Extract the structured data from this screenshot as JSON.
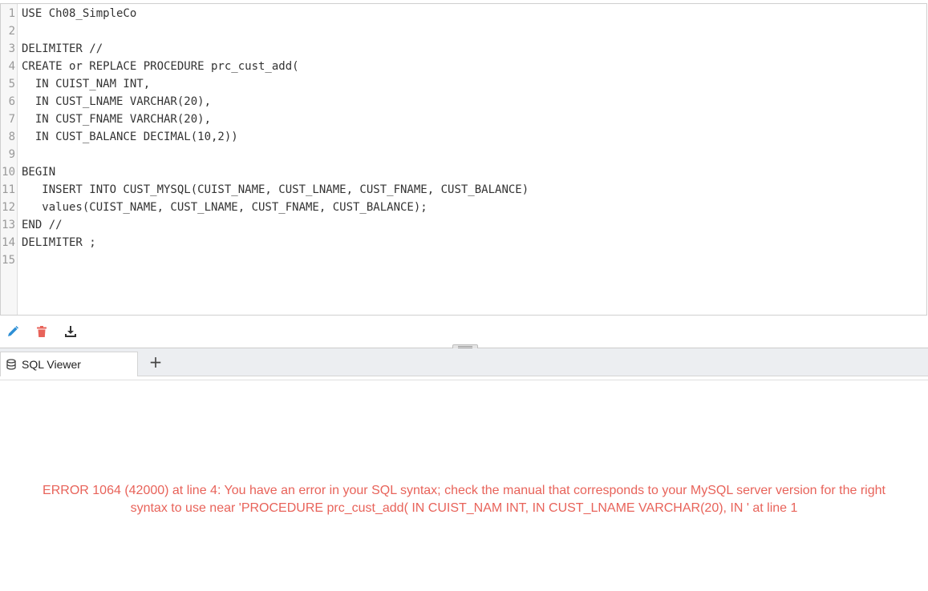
{
  "editor": {
    "line_numbers": [
      "1",
      "2",
      "3",
      "4",
      "5",
      "6",
      "7",
      "8",
      "9",
      "10",
      "11",
      "12",
      "13",
      "14",
      "15"
    ],
    "lines": [
      "USE Ch08_SimpleCo",
      "",
      "DELIMITER //",
      "CREATE or REPLACE PROCEDURE prc_cust_add(",
      "  IN CUIST_NAM INT,",
      "  IN CUST_LNAME VARCHAR(20),",
      "  IN CUST_FNAME VARCHAR(20),",
      "  IN CUST_BALANCE DECIMAL(10,2))",
      "",
      "BEGIN",
      "   INSERT INTO CUST_MYSQL(CUIST_NAME, CUST_LNAME, CUST_FNAME, CUST_BALANCE)",
      "   values(CUIST_NAME, CUST_LNAME, CUST_FNAME, CUST_BALANCE);",
      "END //",
      "DELIMITER ;",
      ""
    ]
  },
  "toolbar": {
    "edit_icon": "pencil-icon",
    "delete_icon": "trash-icon",
    "download_icon": "download-icon",
    "colors": {
      "edit": "#2d8fd5",
      "delete": "#e8635a",
      "download": "#333333"
    }
  },
  "tabs": {
    "active_label": "SQL Viewer",
    "active_icon": "database-icon",
    "add_label": "+"
  },
  "result": {
    "error_line1": "ERROR 1064 (42000) at line 4: You have an error in your SQL syntax; check the manual that corresponds to your MySQL server version for the right",
    "error_line2": "syntax to use near 'PROCEDURE prc_cust_add( IN CUIST_NAM INT, IN CUST_LNAME VARCHAR(20), IN ' at line 1",
    "color": "#e8635a"
  }
}
